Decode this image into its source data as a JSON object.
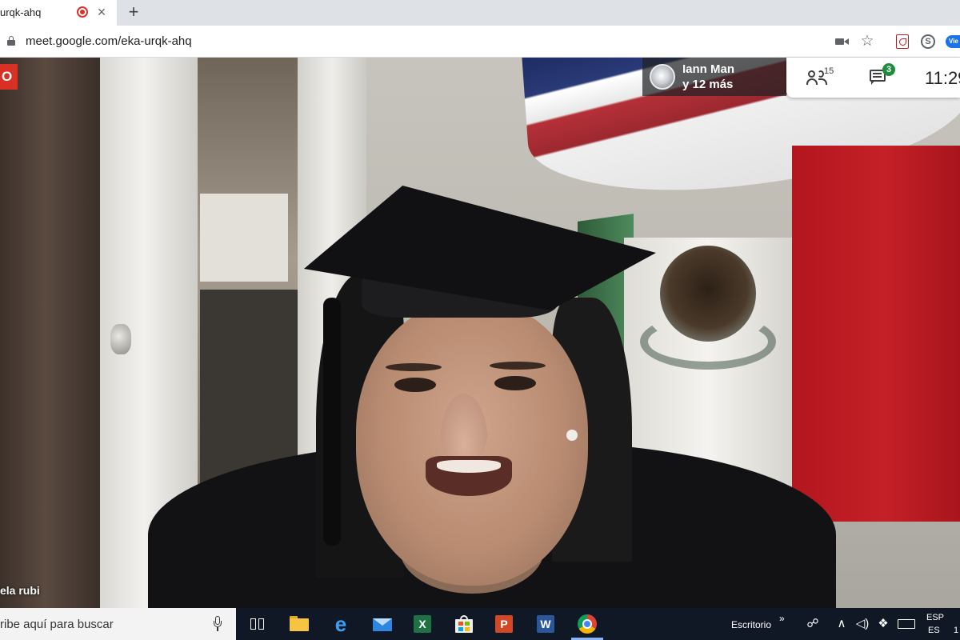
{
  "browser": {
    "tab_title": "urqk-ahq",
    "tab_close": "×",
    "new_tab": "+",
    "url": "meet.google.com/eka-urqk-ahq",
    "star": "☆",
    "skype_glyph": "S",
    "extension_label": "Vie"
  },
  "meet": {
    "recording_badge": "O",
    "active_speaker": {
      "name": "Iann Man",
      "others": "y 12 más"
    },
    "participants_count": "15",
    "unread_messages": "3",
    "clock": "11:29",
    "tile_name": "ela rubi"
  },
  "taskbar": {
    "search_placeholder": "ribe aquí para buscar",
    "apps": [
      {
        "name": "Excel",
        "glyph": "X",
        "color": "#1e7145"
      },
      {
        "name": "PowerPoint",
        "glyph": "P",
        "color": "#d24726"
      },
      {
        "name": "Word",
        "glyph": "W",
        "color": "#2b579a"
      }
    ],
    "edge_glyph": "e",
    "desktop_label": "Escritorio",
    "desktop_arrow": "»",
    "tray_glyphs": {
      "people": "☍",
      "up": "∧",
      "volume": "◁)",
      "dropbox": "❖"
    },
    "lang_code": "ESP",
    "lang_region": "ES",
    "clock_partial": "1"
  }
}
